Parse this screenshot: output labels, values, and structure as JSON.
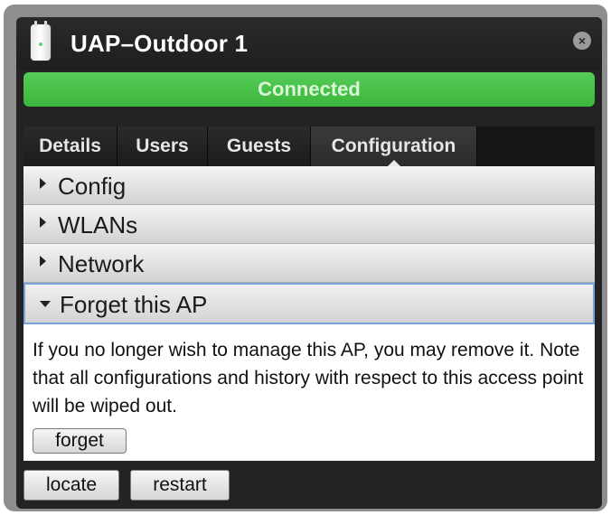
{
  "window": {
    "title": "UAP–Outdoor 1",
    "close_icon": "close-icon",
    "device_icon": "access-point-icon"
  },
  "status": {
    "label": "Connected",
    "color": "#44bd44"
  },
  "tabs": [
    {
      "label": "Details",
      "active": false
    },
    {
      "label": "Users",
      "active": false
    },
    {
      "label": "Guests",
      "active": false
    },
    {
      "label": "Configuration",
      "active": true
    }
  ],
  "sections": [
    {
      "label": "Config",
      "expanded": false
    },
    {
      "label": "WLANs",
      "expanded": false
    },
    {
      "label": "Network",
      "expanded": false
    },
    {
      "label": "Forget this AP",
      "expanded": true
    }
  ],
  "forget_section": {
    "description": "If you no longer wish to manage this AP, you may remove it. Note that all configurations and history with respect to this access point will be wiped out.",
    "button_label": "forget"
  },
  "footer": {
    "locate_label": "locate",
    "restart_label": "restart"
  }
}
